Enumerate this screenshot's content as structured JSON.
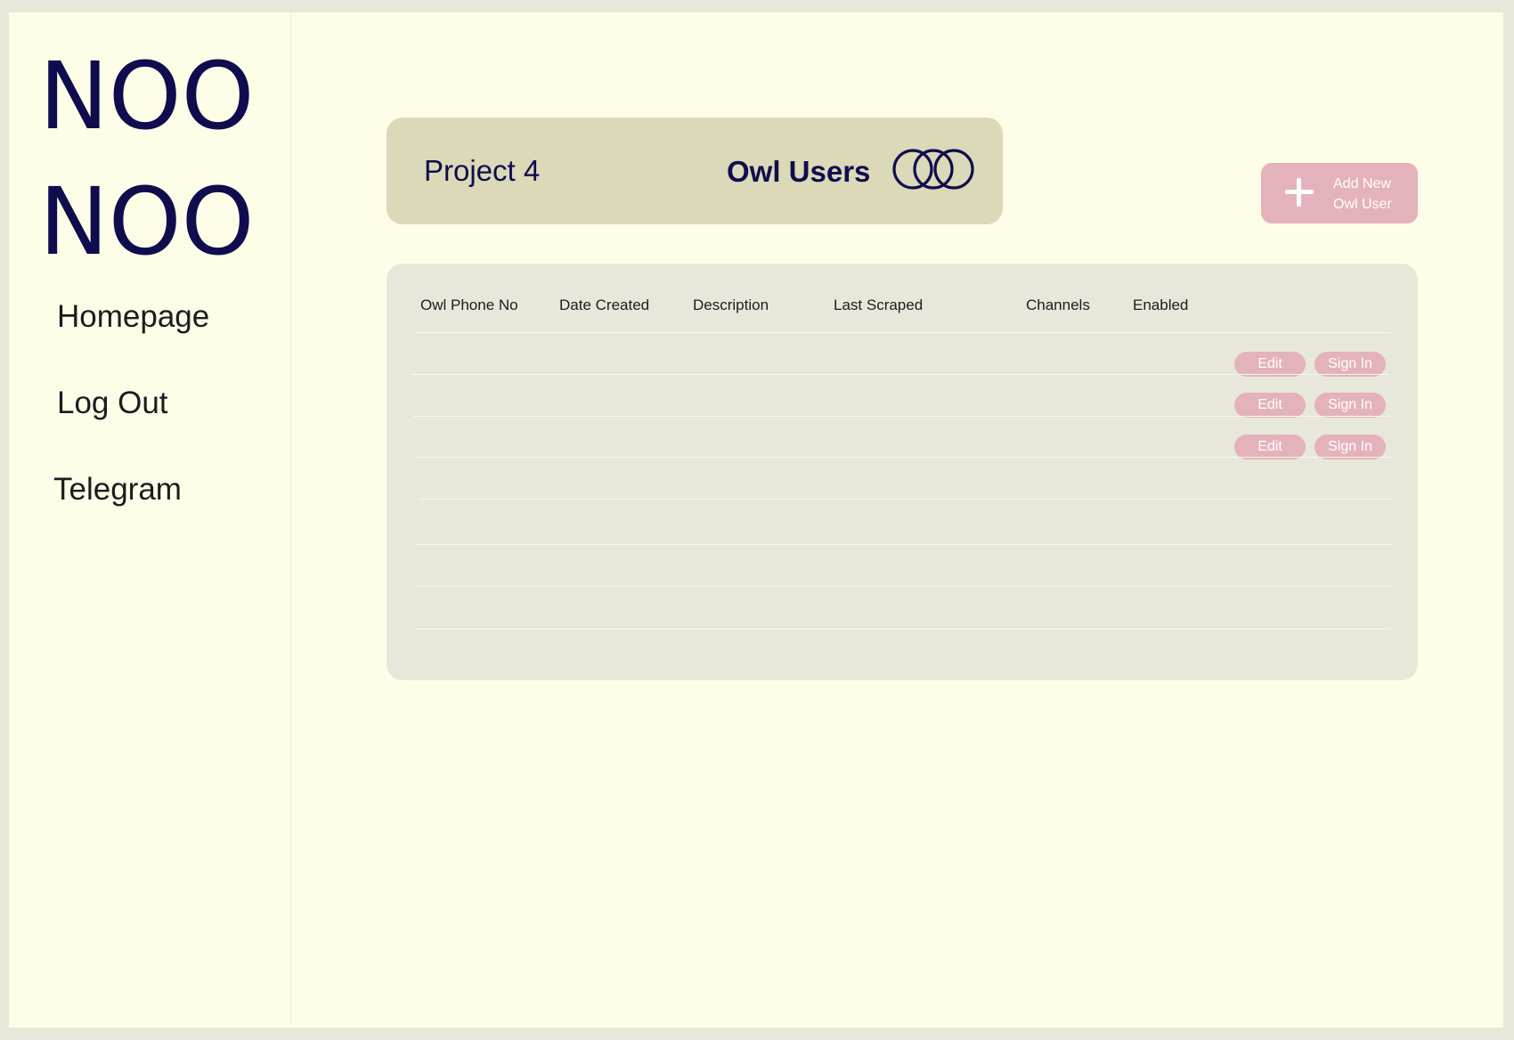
{
  "sidebar": {
    "logo_line1": "NOO",
    "logo_line2": "NOO",
    "nav": [
      "Homepage",
      "Log Out",
      "Telegram"
    ]
  },
  "header": {
    "project": "Project 4",
    "section_title": "Owl Users",
    "section_icon": "three-rings-icon"
  },
  "add_button": {
    "label_line1": "Add New",
    "label_line2": "Owl User",
    "icon": "plus-icon"
  },
  "table": {
    "columns": [
      "Owl Phone No",
      "Date Created",
      "Description",
      "Last Scraped",
      "Channels",
      "Enabled"
    ],
    "rows": [
      {
        "edit": "Edit",
        "sign_in": "Sign In"
      },
      {
        "edit": "Edit",
        "sign_in": "Sign In"
      },
      {
        "edit": "Edit",
        "sign_in": "Sign In"
      }
    ]
  },
  "colors": {
    "page_bg": "#fefee8",
    "outer_bg": "#e7e8d9",
    "brand_navy": "#100d4e",
    "title_card": "#dbd9b7",
    "table_card": "#e7e8d9",
    "button_pink": "#e4b2bb"
  }
}
